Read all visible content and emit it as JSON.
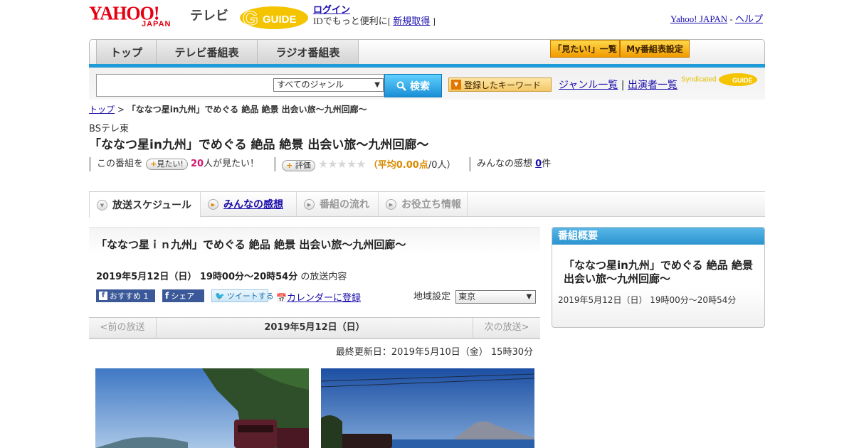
{
  "header": {
    "logo_text": "YAHOO!",
    "logo_sub": "JAPAN",
    "tv_label": "テレビ",
    "gguide_logo": "G-GUIDE",
    "login_label": "ログイン",
    "login_sub_prefix": "IDでもっと便利に[",
    "signup_label": "新規取得",
    "login_sub_suffix": "]",
    "yahoo_japan_link": "Yahoo! JAPAN",
    "separator": "-",
    "help_link": "ヘルプ"
  },
  "nav": {
    "tabs": [
      {
        "label": "トップ"
      },
      {
        "label": "テレビ番組表"
      },
      {
        "label": "ラジオ番組表"
      }
    ],
    "mitai_list_btn": "「見たい!」一覧",
    "my_schedule_btn": "My番組表設定"
  },
  "search": {
    "genre_selected": "すべてのジャンル",
    "search_btn": "検索",
    "keyword_btn": "登録したキーワード",
    "genre_list_link": "ジャンル一覧",
    "link_sep": "|",
    "performer_link": "出演者一覧",
    "syndicated_label": "Syndicated"
  },
  "breadcrumb": {
    "home": "トップ",
    "sep": ">",
    "current": "「ななつ星in九州」でめぐる 絶品 絶景 出会い旅～九州回廊～"
  },
  "program": {
    "channel": "BSテレ東",
    "title": "「ななつ星in九州」でめぐる 絶品 絶景 出会い旅～九州回廊～",
    "stat_prefix": "この番組を",
    "mitai_pill": "見たい!",
    "mitai_count": "20",
    "mitai_suffix": "人が見たい！",
    "rating_pill": "評価",
    "stars": "★★★★★",
    "avg_open": "（",
    "avg_label": "平均0.00点",
    "avg_tail": "/0人）",
    "review_label": "みんなの感想",
    "review_count": "0",
    "review_unit": "件"
  },
  "subtabs": [
    {
      "label": "放送スケジュール"
    },
    {
      "label": "みんなの感想"
    },
    {
      "label": "番組の流れ"
    },
    {
      "label": "お役立ち情報"
    }
  ],
  "episode": {
    "title": "「ななつ星ｉｎ九州」でめぐる 絶品 絶景 出会い旅～九州回廊～",
    "datetime": "2019年5月12日（日）  19時00分～20時54分",
    "datetime_suffix": "の放送内容",
    "fb_recommend": "おすすめ 1",
    "fb_share": "シェア",
    "tweet": "ツイートする",
    "calendar_link": "カレンダーに登録",
    "region_label": "地域設定",
    "region_value": "東京"
  },
  "datenav": {
    "prev": "<前の放送",
    "current": "2019年5月12日（日）",
    "next": "次の放送>"
  },
  "updated": "最終更新日：2019年5月10日（金）  15時30分",
  "side": {
    "heading": "番組概要",
    "title": "「ななつ星in九州」でめぐる 絶品 絶景 出会い旅～九州回廊～",
    "time": "2019年5月12日（日）  19時00分～20時54分"
  },
  "colors": {
    "accent_blue": "#1e9bd7",
    "yahoo_red": "#e60012",
    "pink": "#d6166d",
    "orange": "#d98a00"
  }
}
